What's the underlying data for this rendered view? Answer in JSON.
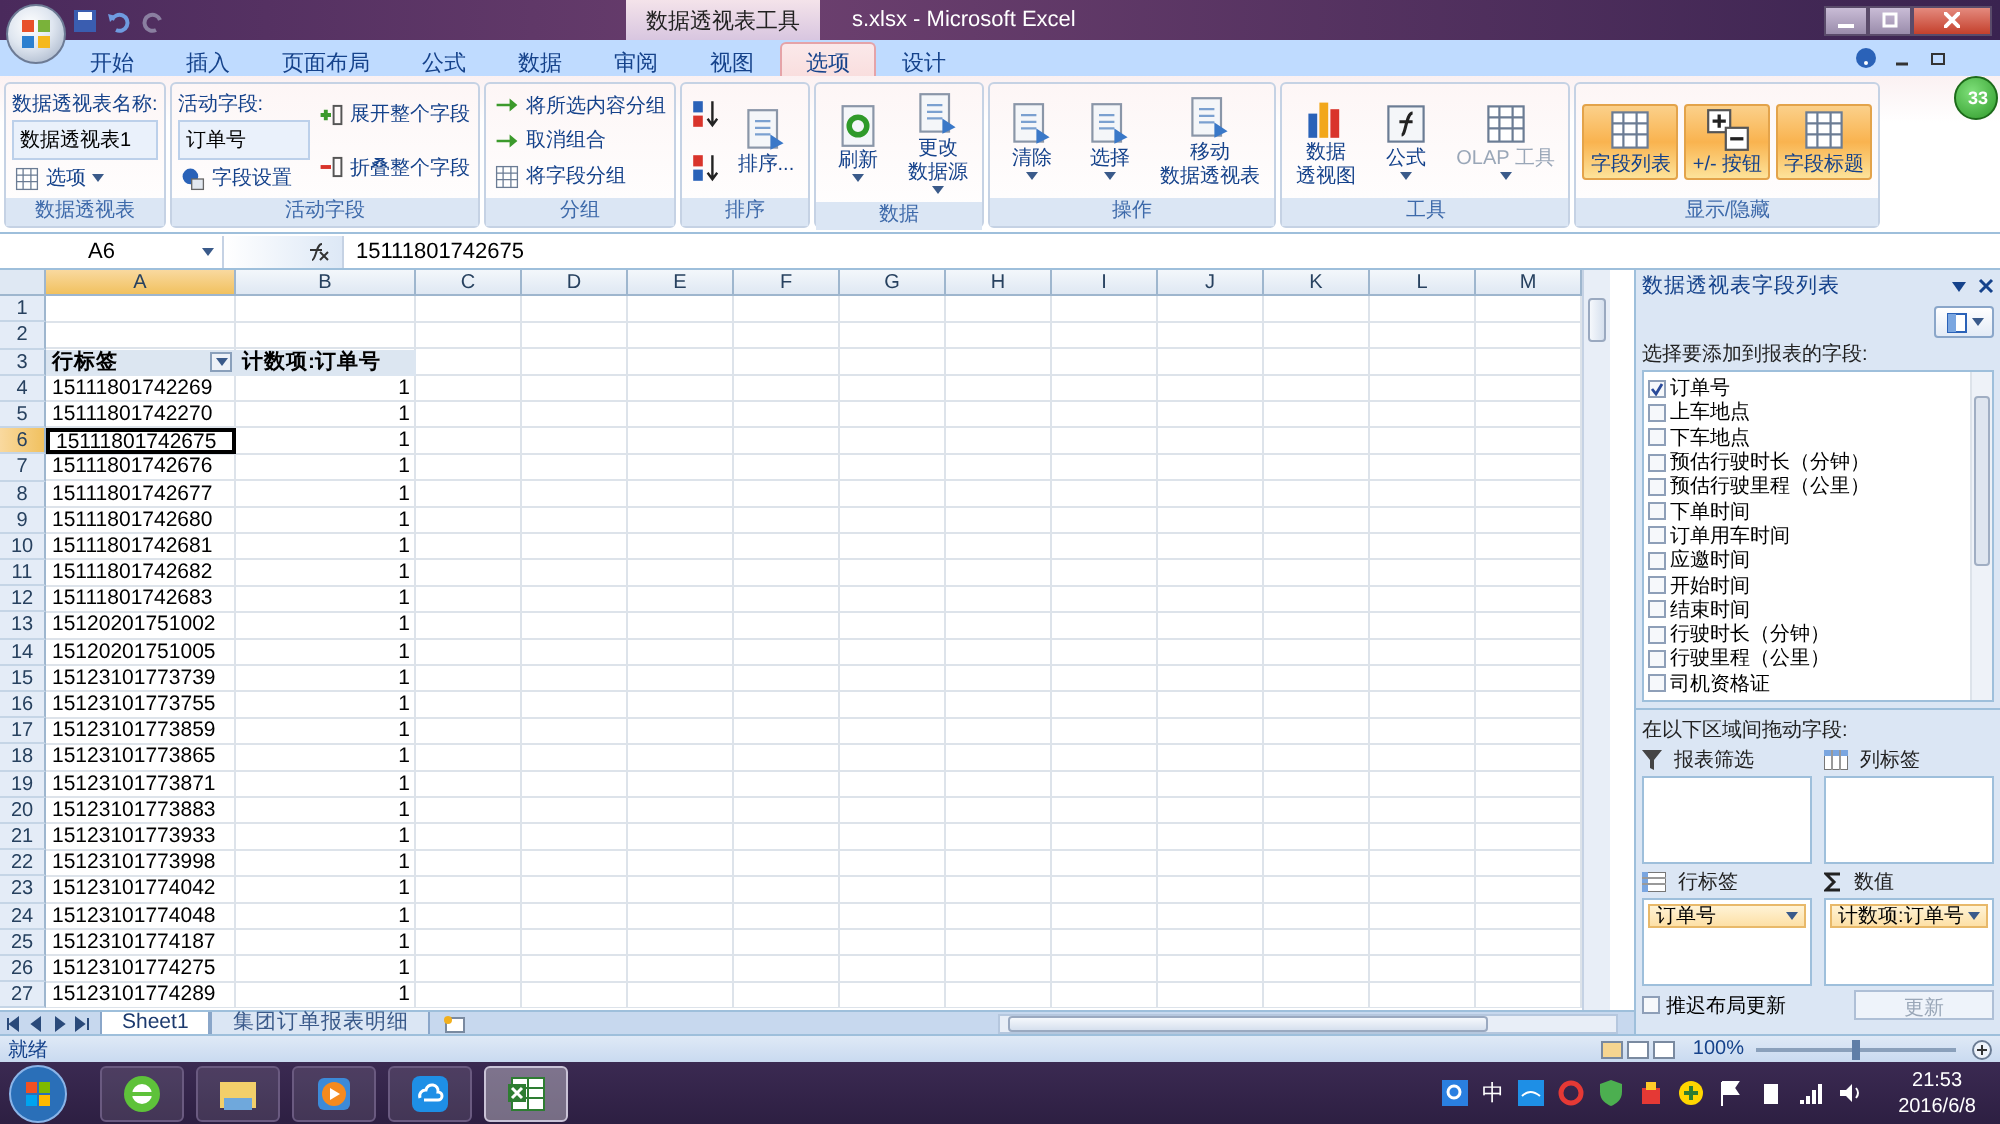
{
  "title_bar": {
    "contextual_title": "数据透视表工具",
    "title": "s.xlsx - Microsoft Excel"
  },
  "tabs": [
    {
      "label": "开始",
      "selected": false
    },
    {
      "label": "插入",
      "selected": false
    },
    {
      "label": "页面布局",
      "selected": false
    },
    {
      "label": "公式",
      "selected": false
    },
    {
      "label": "数据",
      "selected": false
    },
    {
      "label": "审阅",
      "selected": false
    },
    {
      "label": "视图",
      "selected": false
    },
    {
      "label": "选项",
      "selected": true
    },
    {
      "label": "设计",
      "selected": false
    }
  ],
  "badge": "33",
  "ribbon_groups": [
    {
      "label": "数据透视表",
      "columns": [
        [
          {
            "kind": "caption",
            "label": "数据透视表名称:"
          },
          {
            "kind": "field",
            "value": "数据透视表1"
          },
          {
            "kind": "small",
            "label": "选项",
            "dropdown": true
          }
        ]
      ]
    },
    {
      "label": "活动字段",
      "columns": [
        [
          {
            "kind": "caption",
            "label": "活动字段:"
          },
          {
            "kind": "field",
            "value": "订单号"
          },
          {
            "kind": "small",
            "label": "字段设置"
          }
        ],
        [
          {
            "kind": "small",
            "label": "展开整个字段"
          },
          {
            "kind": "small",
            "label": "折叠整个字段"
          }
        ]
      ]
    },
    {
      "label": "分组",
      "columns": [
        [
          {
            "kind": "small",
            "label": "将所选内容分组"
          },
          {
            "kind": "small",
            "label": "取消组合"
          },
          {
            "kind": "small",
            "label": "将字段分组"
          }
        ]
      ]
    },
    {
      "label": "排序",
      "columns": [
        [
          {
            "kind": "icon"
          },
          {
            "kind": "icon"
          }
        ],
        [
          {
            "kind": "large",
            "label": "排序..."
          }
        ]
      ]
    },
    {
      "label": "数据",
      "columns": [
        [
          {
            "kind": "large",
            "label": "刷新",
            "dropdown": true
          }
        ],
        [
          {
            "kind": "large",
            "label_lines": [
              "更改",
              "数据源"
            ],
            "dropdown": true
          }
        ]
      ]
    },
    {
      "label": "操作",
      "columns": [
        [
          {
            "kind": "large",
            "label": "清除",
            "dropdown": true
          }
        ],
        [
          {
            "kind": "large",
            "label": "选择",
            "dropdown": true
          }
        ],
        [
          {
            "kind": "large",
            "label_lines": [
              "移动",
              "数据透视表"
            ]
          }
        ]
      ]
    },
    {
      "label": "工具",
      "columns": [
        [
          {
            "kind": "large",
            "label_lines": [
              "数据",
              "透视图"
            ]
          }
        ],
        [
          {
            "kind": "large",
            "label": "公式",
            "dropdown": true
          }
        ],
        [
          {
            "kind": "large",
            "label": "OLAP 工具",
            "dropdown": true,
            "disabled": true
          }
        ]
      ]
    },
    {
      "label": "显示/隐藏",
      "columns": [
        [
          {
            "kind": "toggle",
            "label": "字段列表",
            "on": true
          }
        ],
        [
          {
            "kind": "toggle",
            "label": "+/- 按钮",
            "on": true
          }
        ],
        [
          {
            "kind": "toggle",
            "label": "字段标题",
            "on": true
          }
        ]
      ]
    }
  ],
  "formula_bar": {
    "cell": "A6",
    "value": "15111801742675"
  },
  "sheet": {
    "columns": [
      {
        "label": "A",
        "selected": true
      },
      {
        "label": "B",
        "selected": false
      },
      {
        "label": "C",
        "selected": false
      },
      {
        "label": "D",
        "selected": false
      },
      {
        "label": "E",
        "selected": false
      },
      {
        "label": "F",
        "selected": false
      },
      {
        "label": "G",
        "selected": false
      },
      {
        "label": "H",
        "selected": false
      },
      {
        "label": "I",
        "selected": false
      },
      {
        "label": "J",
        "selected": false
      },
      {
        "label": "K",
        "selected": false
      },
      {
        "label": "L",
        "selected": false
      },
      {
        "label": "M",
        "selected": false
      }
    ],
    "rows": [
      {
        "number": "1",
        "selected": false,
        "kind": "empty"
      },
      {
        "number": "2",
        "selected": false,
        "kind": "empty"
      },
      {
        "number": "3",
        "selected": false,
        "kind": "header",
        "label": "行标签",
        "value": "计数项:订单号"
      },
      {
        "number": "4",
        "selected": false,
        "kind": "data",
        "label": "15111801742269",
        "value": "1"
      },
      {
        "number": "5",
        "selected": false,
        "kind": "data",
        "label": "15111801742270",
        "value": "1"
      },
      {
        "number": "6",
        "selected": true,
        "kind": "data",
        "label": "15111801742675",
        "value": "1"
      },
      {
        "number": "7",
        "selected": false,
        "kind": "data",
        "label": "15111801742676",
        "value": "1"
      },
      {
        "number": "8",
        "selected": false,
        "kind": "data",
        "label": "15111801742677",
        "value": "1"
      },
      {
        "number": "9",
        "selected": false,
        "kind": "data",
        "label": "15111801742680",
        "value": "1"
      },
      {
        "number": "10",
        "selected": false,
        "kind": "data",
        "label": "15111801742681",
        "value": "1"
      },
      {
        "number": "11",
        "selected": false,
        "kind": "data",
        "label": "15111801742682",
        "value": "1"
      },
      {
        "number": "12",
        "selected": false,
        "kind": "data",
        "label": "15111801742683",
        "value": "1"
      },
      {
        "number": "13",
        "selected": false,
        "kind": "data",
        "label": "15120201751002",
        "value": "1"
      },
      {
        "number": "14",
        "selected": false,
        "kind": "data",
        "label": "15120201751005",
        "value": "1"
      },
      {
        "number": "15",
        "selected": false,
        "kind": "data",
        "label": "15123101773739",
        "value": "1"
      },
      {
        "number": "16",
        "selected": false,
        "kind": "data",
        "label": "15123101773755",
        "value": "1"
      },
      {
        "number": "17",
        "selected": false,
        "kind": "data",
        "label": "15123101773859",
        "value": "1"
      },
      {
        "number": "18",
        "selected": false,
        "kind": "data",
        "label": "15123101773865",
        "value": "1"
      },
      {
        "number": "19",
        "selected": false,
        "kind": "data",
        "label": "15123101773871",
        "value": "1"
      },
      {
        "number": "20",
        "selected": false,
        "kind": "data",
        "label": "15123101773883",
        "value": "1"
      },
      {
        "number": "21",
        "selected": false,
        "kind": "data",
        "label": "15123101773933",
        "value": "1"
      },
      {
        "number": "22",
        "selected": false,
        "kind": "data",
        "label": "15123101773998",
        "value": "1"
      },
      {
        "number": "23",
        "selected": false,
        "kind": "data",
        "label": "15123101774042",
        "value": "1"
      },
      {
        "number": "24",
        "selected": false,
        "kind": "data",
        "label": "15123101774048",
        "value": "1"
      },
      {
        "number": "25",
        "selected": false,
        "kind": "data",
        "label": "15123101774187",
        "value": "1"
      },
      {
        "number": "26",
        "selected": false,
        "kind": "data",
        "label": "15123101774275",
        "value": "1"
      },
      {
        "number": "27",
        "selected": false,
        "kind": "data",
        "label": "15123101774289",
        "value": "1"
      }
    ]
  },
  "sheet_tabs": [
    {
      "label": "Sheet1",
      "selected": true
    },
    {
      "label": "集团订单报表明细",
      "selected": false
    }
  ],
  "status_bar": {
    "status": "就绪",
    "zoom": {
      "reading": "100%",
      "level": 0.5
    }
  },
  "field_panel": {
    "title": "数据透视表字段列表",
    "prompt": "选择要添加到报表的字段:",
    "fields": [
      {
        "label": "订单号",
        "checked": true
      },
      {
        "label": "上车地点",
        "checked": false
      },
      {
        "label": "下车地点",
        "checked": false
      },
      {
        "label": "预估行驶时长（分钟）",
        "checked": false
      },
      {
        "label": "预估行驶里程（公里）",
        "checked": false
      },
      {
        "label": "下单时间",
        "checked": false
      },
      {
        "label": "订单用车时间",
        "checked": false
      },
      {
        "label": "应邀时间",
        "checked": false
      },
      {
        "label": "开始时间",
        "checked": false
      },
      {
        "label": "结束时间",
        "checked": false
      },
      {
        "label": "行驶时长（分钟）",
        "checked": false
      },
      {
        "label": "行驶里程（公里）",
        "checked": false
      },
      {
        "label": "司机资格证",
        "checked": false
      }
    ],
    "drag_prompt": "在以下区域间拖动字段:",
    "areas": [
      {
        "label": "报表筛选",
        "kind": "filter"
      },
      {
        "label": "列标签",
        "kind": "columns"
      },
      {
        "label": "行标签",
        "kind": "rows",
        "items": [
          "订单号"
        ]
      },
      {
        "label": "数值",
        "kind": "values",
        "items": [
          "计数项:订单号"
        ]
      }
    ],
    "defer": {
      "label": "推迟布局更新",
      "checked": false
    },
    "update_button": {
      "label": "更新",
      "disabled": true
    }
  },
  "taskbar": {
    "ime": "中",
    "time": "21:53",
    "date": "2016/6/8"
  }
}
